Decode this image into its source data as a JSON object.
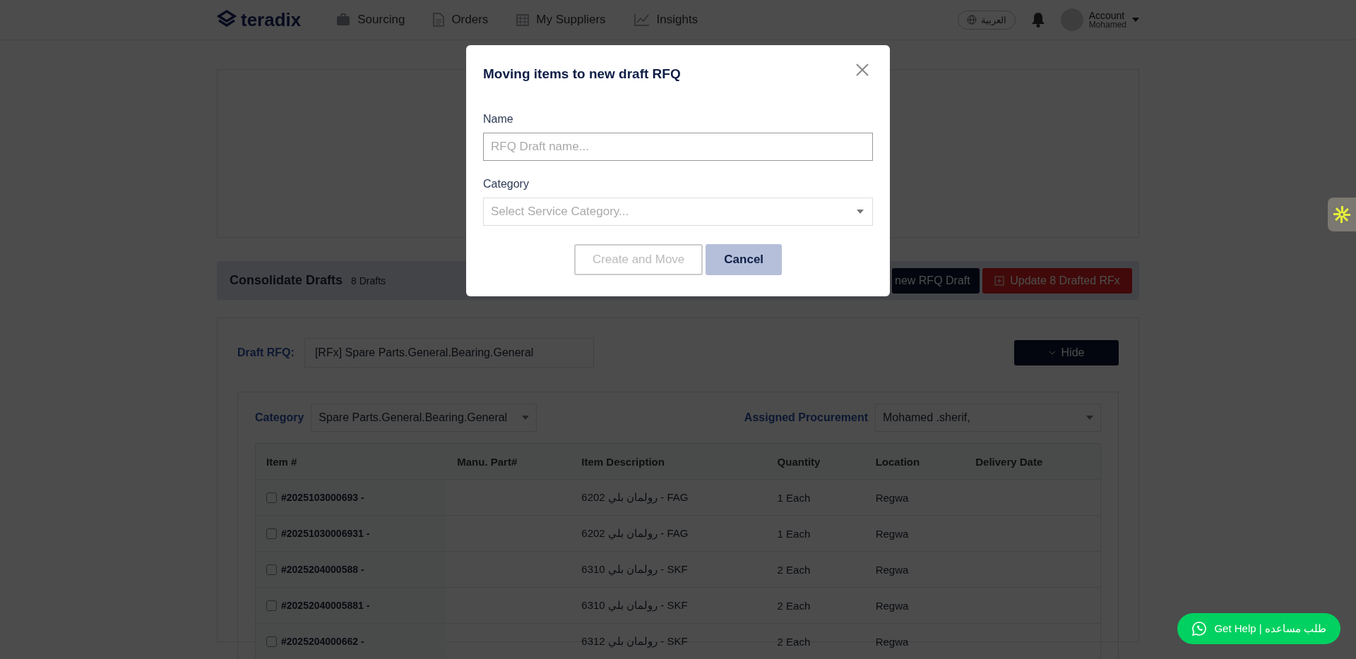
{
  "header": {
    "logo": "teradix",
    "nav": [
      {
        "label": "Sourcing"
      },
      {
        "label": "Orders"
      },
      {
        "label": "My Suppliers"
      },
      {
        "label": "Insights"
      }
    ],
    "language": "العربية",
    "account": {
      "label": "Account",
      "user": "Mohamed"
    }
  },
  "consolidate": {
    "title": "Consolidate Drafts",
    "count": "8 Drafts",
    "buttons": [
      {
        "label": "new RFQ Draft",
        "kind": "dark"
      },
      {
        "label": "Update 8 Drafted RFx",
        "kind": "danger"
      }
    ]
  },
  "draft": {
    "label": "Draft RFQ:",
    "value": "[RFx] Spare Parts.General.Bearing.General",
    "hide_button": "Hide"
  },
  "filters": {
    "category_label": "Category",
    "category_value": "Spare Parts.General.Bearing.General",
    "procurement_label": "Assigned Procurement",
    "procurement_value": "Mohamed .sherif,"
  },
  "table": {
    "columns": [
      "Item #",
      "Manu. Part#",
      "Item Description",
      "Quantity",
      "Location",
      "Delivery Date"
    ],
    "rows": [
      {
        "item": "#2025103000693 -",
        "part": "",
        "description": "6202 رولمان بلي - FAG",
        "quantity": "1 Each",
        "location": "Regwa",
        "checked": false
      },
      {
        "item": "#20251030006931 -",
        "part": "",
        "description": "6202 رولمان بلي - FAG",
        "quantity": "1 Each",
        "location": "Regwa",
        "checked": false
      },
      {
        "item": "#2025204000588 -",
        "part": "",
        "description": "6310 رولمان بلي - SKF",
        "quantity": "2 Each",
        "location": "Regwa",
        "checked": false
      },
      {
        "item": "#20252040005881 -",
        "part": "",
        "description": "6310 رولمان بلي - SKF",
        "quantity": "2 Each",
        "location": "Regwa",
        "checked": false
      },
      {
        "item": "#2025204000662 -",
        "part": "",
        "description": "6312 رولمان بلي - SKF",
        "quantity": "2 Each",
        "location": "Regwa",
        "checked": false
      }
    ]
  },
  "modal": {
    "title": "Moving items to new draft RFQ",
    "name_label": "Name",
    "name_placeholder": "RFQ Draft name...",
    "category_label": "Category",
    "category_placeholder": "Select Service Category...",
    "buttons": [
      {
        "label": "Create and Move",
        "kind": "outline",
        "disabled": true
      },
      {
        "label": "Cancel",
        "kind": "secondary",
        "disabled": false
      }
    ]
  },
  "help_button": "Get Help | طلب مساعده"
}
